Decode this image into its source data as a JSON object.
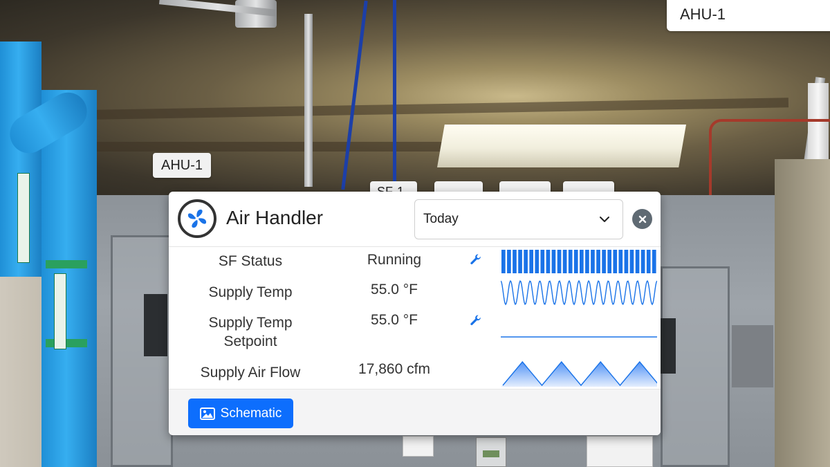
{
  "asset_selector": {
    "value": "AHU-1"
  },
  "floating_tags": {
    "ahu": "AHU-1",
    "sf": "SF-1"
  },
  "popup": {
    "title": "Air Handler",
    "icon": "fan-icon",
    "time_range": {
      "selected": "Today"
    },
    "points": [
      {
        "label": "SF Status",
        "value": "Running",
        "has_override": true,
        "trend": "square-wave"
      },
      {
        "label": "Supply Temp",
        "value": "55.0 °F",
        "has_override": false,
        "trend": "oscillating"
      },
      {
        "label": "Supply Temp Setpoint",
        "value": "55.0 °F",
        "has_override": true,
        "trend": "flat"
      },
      {
        "label": "Supply Air Flow",
        "value": "17,860 cfm",
        "has_override": false,
        "trend": "triangle-wave"
      }
    ],
    "footer": {
      "schematic_label": "Schematic"
    }
  },
  "colors": {
    "accent": "#0d6efd",
    "trend_line": "#1a73e8",
    "trend_fill": "#4a8ef5",
    "close_bg": "#5f6a73"
  }
}
